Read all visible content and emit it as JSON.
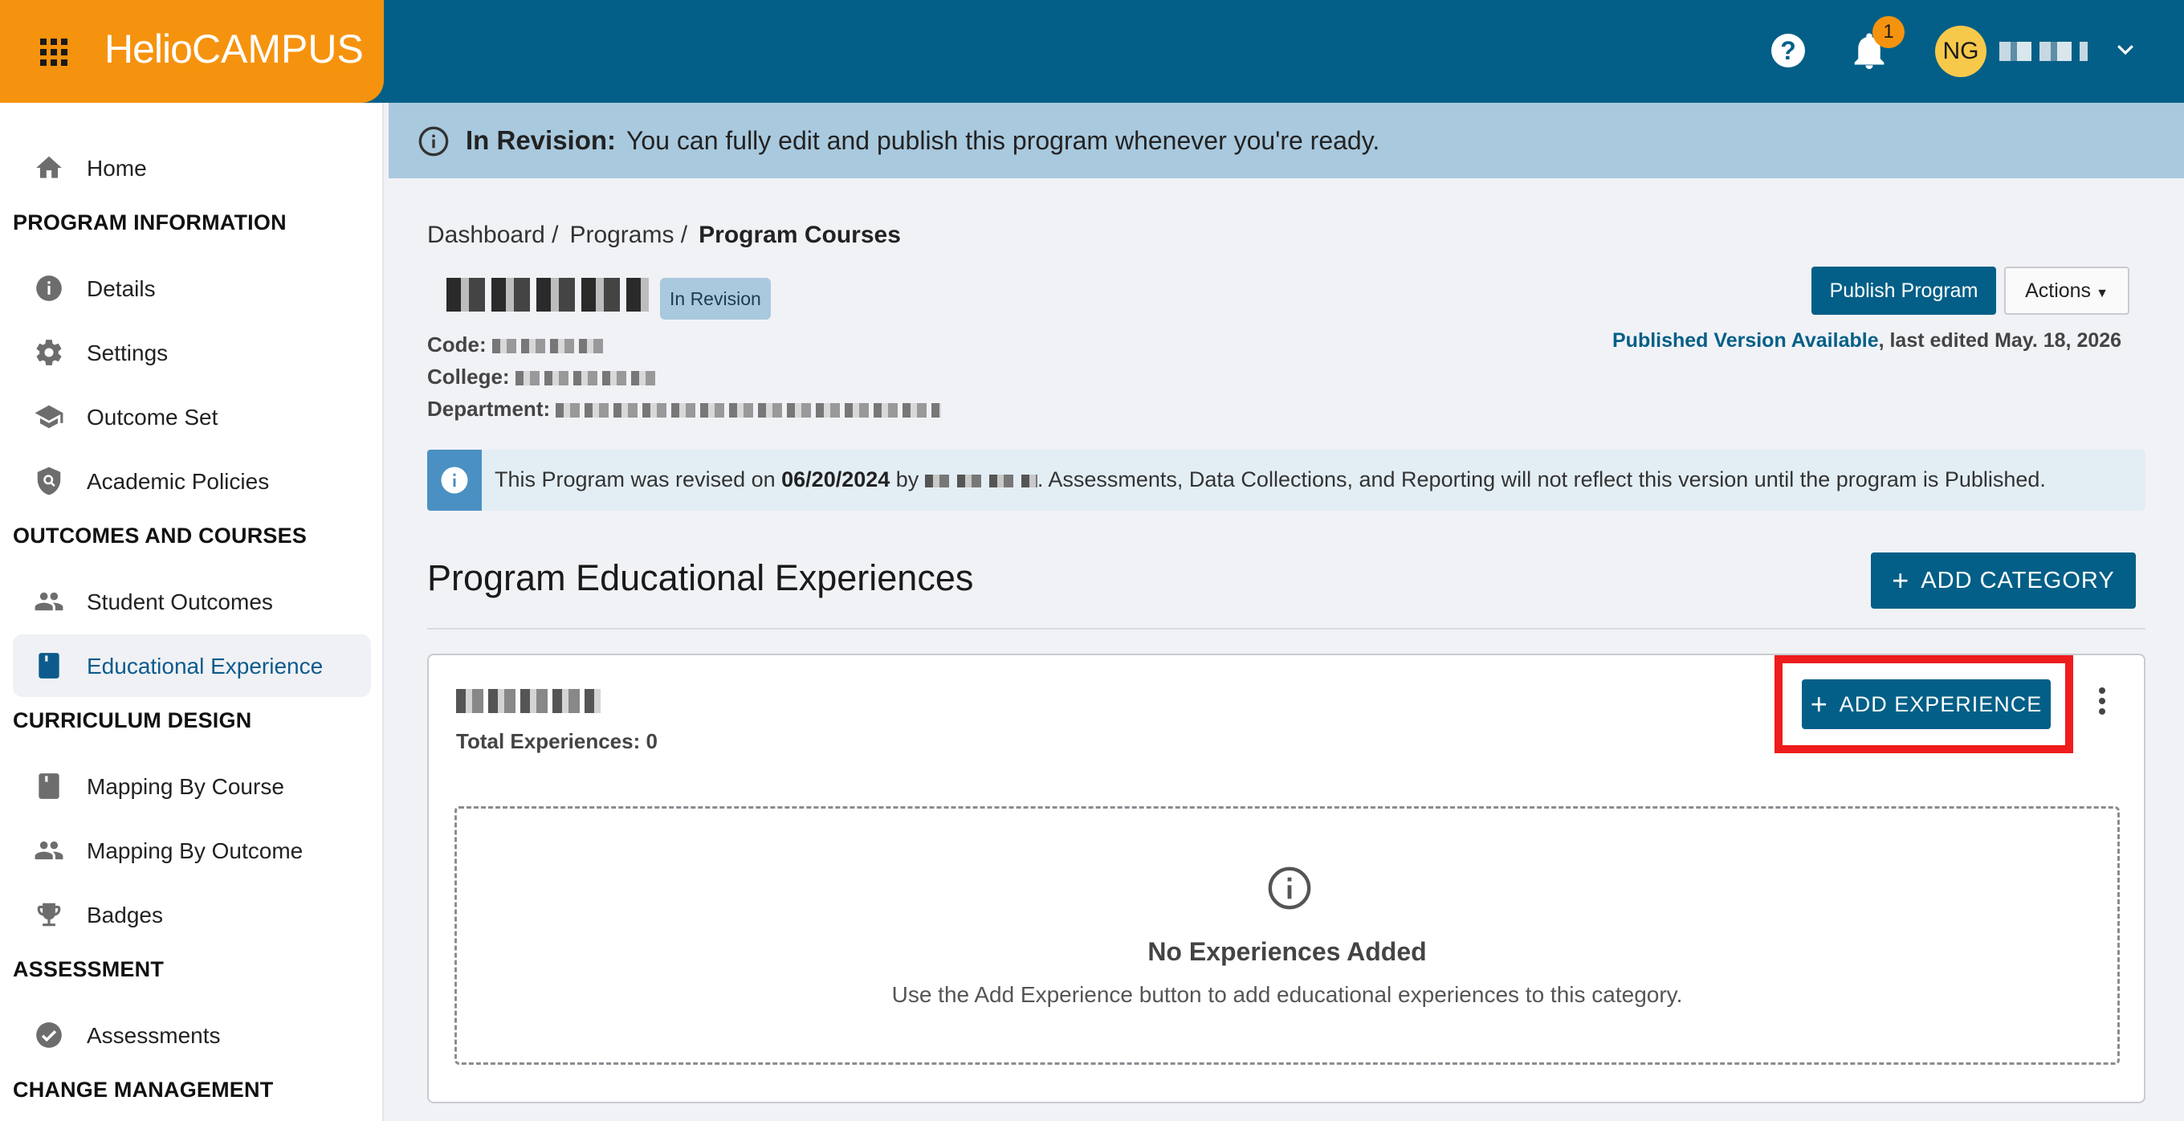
{
  "header": {
    "logo_bold": "Helio",
    "logo_light": "CAMPUS",
    "notification_count": "1",
    "user_initials": "NG"
  },
  "sidebar": {
    "home": "Home",
    "sections": [
      {
        "title": "PROGRAM INFORMATION",
        "items": [
          "Details",
          "Settings",
          "Outcome Set",
          "Academic Policies"
        ]
      },
      {
        "title": "OUTCOMES AND COURSES",
        "items": [
          "Student Outcomes",
          "Educational Experience"
        ]
      },
      {
        "title": "CURRICULUM DESIGN",
        "items": [
          "Mapping By Course",
          "Mapping By Outcome",
          "Badges"
        ]
      },
      {
        "title": "ASSESSMENT",
        "items": [
          "Assessments"
        ]
      },
      {
        "title": "CHANGE MANAGEMENT",
        "items": []
      }
    ],
    "active_item": "Educational Experience"
  },
  "banner": {
    "label": "In Revision:",
    "text": "You can fully edit and publish this program whenever you're ready."
  },
  "breadcrumb": {
    "items": [
      "Dashboard /",
      "Programs /"
    ],
    "current": "Program Courses"
  },
  "program": {
    "status_badge": "In Revision",
    "code_label": "Code:",
    "college_label": "College:",
    "department_label": "Department:",
    "publish_button": "Publish Program",
    "actions_button": "Actions",
    "published_link": "Published Version Available",
    "last_edited": ", last edited May. 18, 2026"
  },
  "alert": {
    "prefix": "This Program was revised on ",
    "date": "06/20/2024",
    "by": " by",
    "suffix": ". Assessments, Data Collections, and Reporting will not reflect this version until the program is Published."
  },
  "main": {
    "section_title": "Program Educational Experiences",
    "add_category_button": "ADD CATEGORY"
  },
  "category_card": {
    "total_experiences": "Total Experiences: 0",
    "add_experience_button": "ADD EXPERIENCE",
    "empty_title": "No Experiences Added",
    "empty_description": "Use the Add Experience button to add educational experiences to this category."
  },
  "colors": {
    "brand_orange": "#f6930e",
    "header_blue": "#035f87",
    "banner_blue": "#a9c9de",
    "highlight_red": "#ee1c1c"
  }
}
